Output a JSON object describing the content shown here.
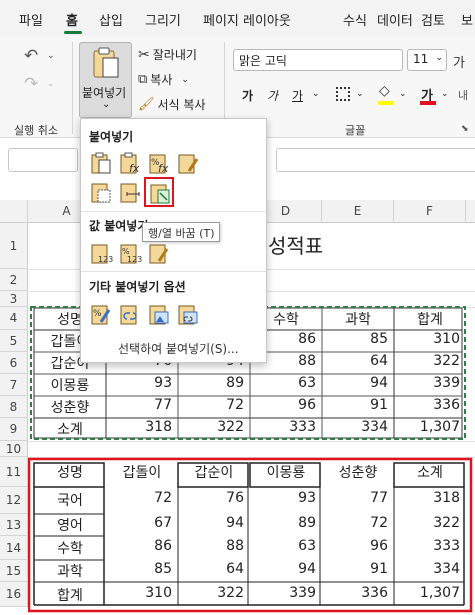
{
  "tabs": [
    "파일",
    "홈",
    "삽입",
    "그리기",
    "페이지 레이아웃",
    "수식",
    "데이터",
    "검토",
    "보"
  ],
  "ribbon": {
    "undo_group_label": "실행 취소",
    "paste_label": "붙여넣기",
    "cut_label": "잘라내기",
    "copy_label": "복사",
    "format_painter_label": "서식 복사",
    "font_name": "맑은 고딕",
    "font_size": "11",
    "font_group_label": "글꼴",
    "bold": "가",
    "italic": "가",
    "underline": "가",
    "font_color_glyph": "가",
    "wrap_label": "내"
  },
  "paste_menu": {
    "paste_heading": "붙여넣기",
    "values_heading": "값 붙여넣기",
    "other_heading": "기타 붙여넣기 옵션",
    "special_label": "선택하여 붙여넣기(S)...",
    "tooltip": "행/열 바꿈 (T)"
  },
  "columns": [
    "A",
    "B",
    "C",
    "D",
    "E",
    "F"
  ],
  "rows": [
    "1",
    "2",
    "3",
    "4",
    "5",
    "6",
    "7",
    "8",
    "9",
    "10",
    "11",
    "12",
    "13",
    "14",
    "15",
    "16"
  ],
  "sheet": {
    "title_partial": "성적표",
    "source_header": [
      "성명",
      "수학",
      "과학",
      "합계"
    ],
    "source_rows": [
      {
        "name": "갑돌이",
        "c": "",
        "d": "86",
        "e": "85",
        "f": "310"
      },
      {
        "name": "갑순이",
        "b": "76",
        "c": "94",
        "d": "88",
        "e": "64",
        "f": "322"
      },
      {
        "name": "이몽룡",
        "b": "93",
        "c": "89",
        "d": "63",
        "e": "94",
        "f": "339"
      },
      {
        "name": "성춘향",
        "b": "77",
        "c": "72",
        "d": "96",
        "e": "91",
        "f": "336"
      },
      {
        "name": "소계",
        "b": "318",
        "c": "322",
        "d": "333",
        "e": "334",
        "f": "1,307"
      }
    ],
    "transposed_header": [
      "성명",
      "갑돌이",
      "갑순이",
      "이몽룡",
      "성춘향",
      "소계"
    ],
    "transposed_rows": [
      [
        "국어",
        "72",
        "76",
        "93",
        "77",
        "318"
      ],
      [
        "영어",
        "67",
        "94",
        "89",
        "72",
        "322"
      ],
      [
        "수학",
        "86",
        "88",
        "63",
        "96",
        "333"
      ],
      [
        "과학",
        "85",
        "64",
        "94",
        "91",
        "334"
      ],
      [
        "합계",
        "310",
        "322",
        "339",
        "336",
        "1,307"
      ]
    ]
  },
  "colors": {
    "accent_green": "#1a7a3c",
    "highlight_red": "#e0141e",
    "dashed_green": "#2f7d4a"
  }
}
